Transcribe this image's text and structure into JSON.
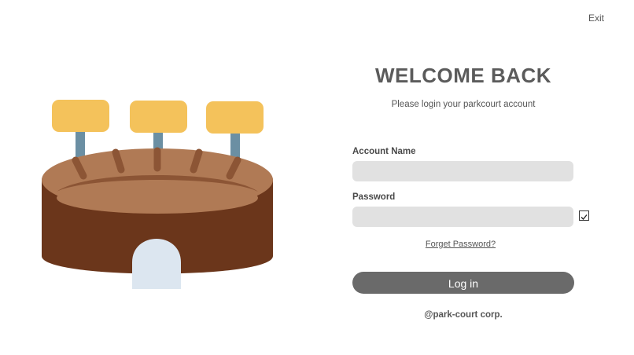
{
  "window": {
    "exit_label": "Exit"
  },
  "login": {
    "title": "WELCOME BACK",
    "subtitle": "Please login your parkcourt account",
    "account_label": "Account Name",
    "account_value": "",
    "password_label": "Password",
    "password_value": "",
    "forget_label": "Forget Password?",
    "login_label": "Log in",
    "footer": "@park-court corp."
  },
  "colors": {
    "button": "#6a6a6a",
    "input_bg": "#e1e1e1",
    "arena_wall": "#6b361b",
    "arena_floor": "#b07a55",
    "arena_floor_shadow": "#8c5535",
    "arena_door": "#dce6f0",
    "light": "#f4c25b",
    "pole": "#6b8fa3"
  },
  "icons": {
    "illustration": "arena-stadium-illustration",
    "checkbox": "checkbox-checked-icon"
  }
}
